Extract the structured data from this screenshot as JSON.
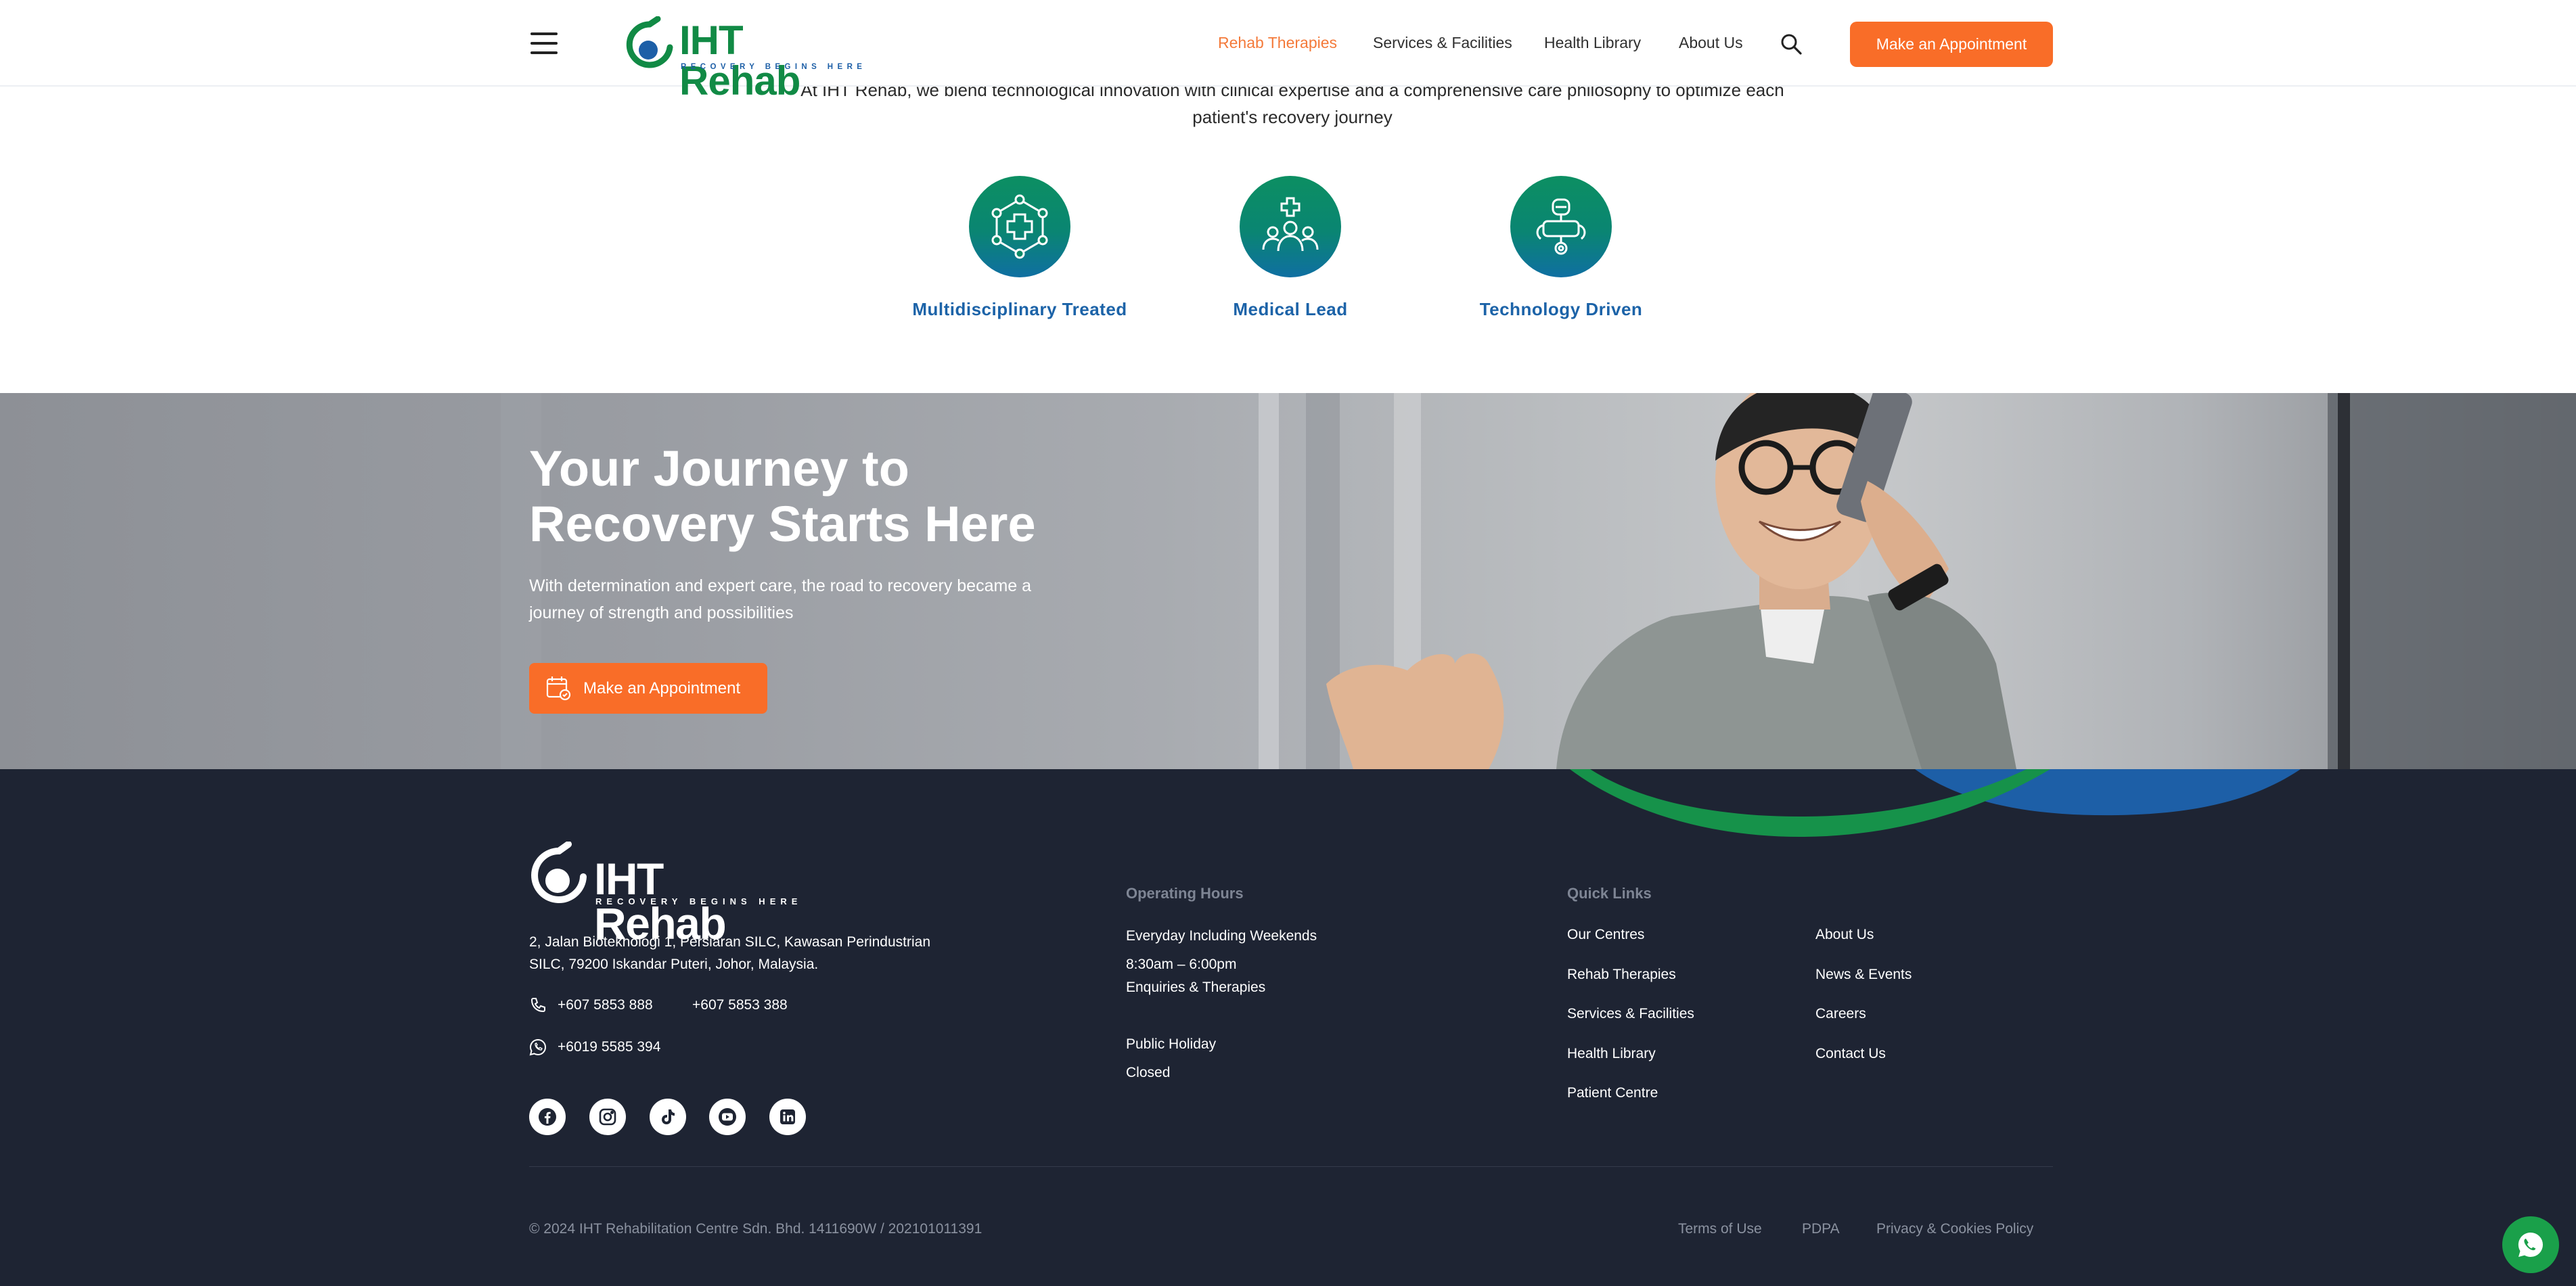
{
  "header": {
    "logo": {
      "name": "IHT Rehab",
      "tagline": "RECOVERY BEGINS HERE"
    },
    "nav": [
      {
        "label": "Rehab Therapies",
        "active": true
      },
      {
        "label": "Services & Facilities",
        "active": false
      },
      {
        "label": "Health Library",
        "active": false
      },
      {
        "label": "About Us",
        "active": false
      }
    ],
    "cta_label": "Make an Appointment",
    "icons": {
      "menu": "hamburger-menu-icon",
      "search": "search-icon"
    }
  },
  "intro": {
    "text": "At IHT Rehab, we blend technological innovation with clinical expertise and a comprehensive care philosophy to optimize each patient's recovery journey",
    "pillars": [
      {
        "label": "Multidisciplinary Treated",
        "icon": "network-cross-icon"
      },
      {
        "label": "Medical Lead",
        "icon": "medical-team-icon"
      },
      {
        "label": "Technology Driven",
        "icon": "robot-tech-icon"
      }
    ]
  },
  "hero": {
    "title": "Your Journey to Recovery Starts Here",
    "subtitle": "With determination and expert care, the road to recovery became a journey of strength and possibilities",
    "button_label": "Make an Appointment",
    "button_icon": "calendar-check-icon"
  },
  "footer": {
    "logo": {
      "name": "IHT Rehab",
      "tagline": "RECOVERY BEGINS HERE"
    },
    "address": "2, Jalan Bioteknologi 1, Persiaran SILC, Kawasan Perindustrian SILC, 79200 Iskandar Puteri, Johor, Malaysia.",
    "phones": [
      "+607 5853 888",
      "+607 5853 388"
    ],
    "whatsapp": "+6019 5585 394",
    "social": [
      "facebook-icon",
      "instagram-icon",
      "tiktok-icon",
      "youtube-icon",
      "linkedin-icon"
    ],
    "hours": {
      "heading": "Operating Hours",
      "line1": "Everyday Including Weekends",
      "line2": "8:30am – 6:00pm",
      "line3": "Enquiries & Therapies",
      "line4": "Public Holiday",
      "line5": "Closed"
    },
    "quick_links": {
      "heading": "Quick Links",
      "col1": [
        "Our Centres",
        "Rehab Therapies",
        "Services & Facilities",
        "Health Library",
        "Patient Centre"
      ],
      "col2": [
        "About Us",
        "News & Events",
        "Careers",
        "Contact Us"
      ]
    },
    "copyright": "© 2024 IHT Rehabilitation Centre Sdn. Bhd. 1411690W / 202101011391",
    "legal": [
      "Terms of Use",
      "PDPA",
      "Privacy & Cookies Policy"
    ]
  },
  "colors": {
    "accent_orange": "#f96d28",
    "brand_green": "#118a45",
    "brand_blue": "#1c63a8",
    "footer_bg": "#1e2433",
    "whatsapp_green": "#1aa04a"
  }
}
